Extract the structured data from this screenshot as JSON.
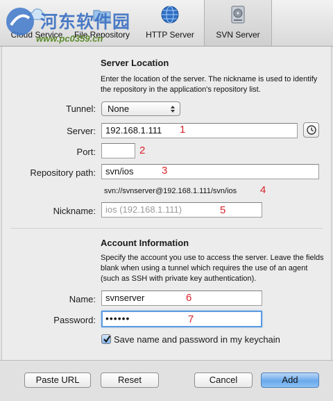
{
  "watermark": {
    "title": "河东软件园",
    "url": "www.pc0359.cn"
  },
  "toolbar": {
    "tabs": [
      {
        "label": "Cloud Service",
        "icon": "cloud-icon"
      },
      {
        "label": "File Repository",
        "icon": "folder-icon"
      },
      {
        "label": "HTTP Server",
        "icon": "globe-icon"
      },
      {
        "label": "SVN Server",
        "icon": "hard-drive-icon",
        "selected": true
      }
    ]
  },
  "server_location": {
    "heading": "Server Location",
    "description": "Enter the location of the server. The nickname is used to identify the repository in the application's repository list.",
    "tunnel_label": "Tunnel:",
    "tunnel_value": "None",
    "server_label": "Server:",
    "server_value": "192.168.1.111",
    "port_label": "Port:",
    "port_value": "",
    "path_label": "Repository path:",
    "path_value": "svn/ios",
    "url_preview": "svn://svnserver@192.168.1.111/svn/ios",
    "nickname_label": "Nickname:",
    "nickname_placeholder": "ios (192.168.1.111)"
  },
  "account": {
    "heading": "Account Information",
    "description": "Specify the account you use to access the server. Leave the fields blank when using a tunnel which requires the use of an agent (such as SSH with private key authentication).",
    "name_label": "Name:",
    "name_value": "svnserver",
    "password_label": "Password:",
    "password_value": "••••••",
    "keychain_label": "Save name and password in my keychain",
    "keychain_checked": true
  },
  "annotations": [
    "1",
    "2",
    "3",
    "4",
    "5",
    "6",
    "7"
  ],
  "footer": {
    "paste_url": "Paste URL",
    "reset": "Reset",
    "cancel": "Cancel",
    "add": "Add"
  },
  "colors": {
    "accent": "#5b9be0",
    "annotation": "#d8232a",
    "default_button": "#6aa9ec"
  }
}
